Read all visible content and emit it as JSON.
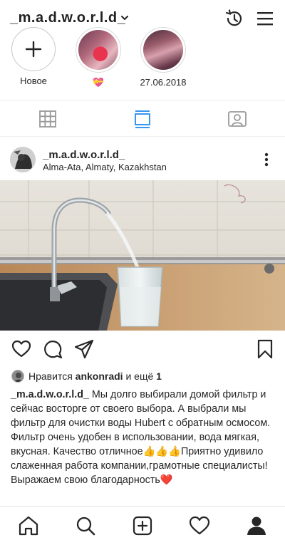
{
  "header": {
    "username": "_m.a.d.w.o.r.l.d_"
  },
  "highlights": [
    {
      "label": "Новое"
    },
    {
      "label": "💝"
    },
    {
      "label": "27.06.2018"
    }
  ],
  "post": {
    "username": "_m.a.d.w.o.r.l.d_",
    "location": "Alma-Ata, Almaty, Kazakhstan",
    "likes_prefix": "Нравится ",
    "likes_user": "ankonradi",
    "likes_middle": " и ещё ",
    "likes_count": "1",
    "caption_user": "_m.a.d.w.o.r.l.d_",
    "caption_text": " Мы долго выбирали домой фильтр и сейчас восторге от своего выбора. А выбрали мы фильтр для очистки воды Hubert с обратным осмосом. Фильтр очень удобен в использовании, вода мягкая, вкусная. Качество отличное👍👍👍Приятно удивило  слаженная работа компании,грамотные специалисты! Выражаем свою благодарность❤️"
  },
  "icons": {
    "header": [
      "chevron-down-icon",
      "history-icon",
      "menu-icon"
    ],
    "tabs": [
      "grid-icon",
      "feed-icon",
      "tagged-icon"
    ],
    "actions": [
      "heart-icon",
      "comment-icon",
      "share-icon",
      "bookmark-icon"
    ],
    "nav": [
      "home-icon",
      "search-icon",
      "add-icon",
      "activity-icon",
      "profile-icon"
    ]
  },
  "colors": {
    "active_tab": "#3897f0",
    "text": "#262626",
    "inactive_icon": "#999999"
  }
}
